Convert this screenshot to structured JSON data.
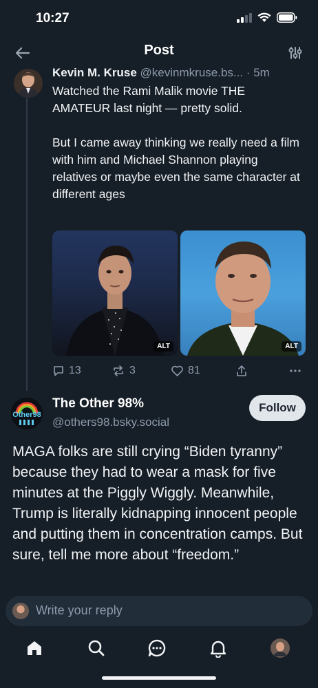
{
  "status": {
    "time": "10:27"
  },
  "header": {
    "title": "Post"
  },
  "parent": {
    "author": "Kevin M. Kruse",
    "handle": "@kevinmkruse.bs...",
    "time": "· 5m",
    "text": "Watched the Rami Malik movie THE AMATEUR last night — pretty solid.\n\nBut I came away thinking we really need a film with him and Michael Shannon playing relatives or maybe even the same character at different ages",
    "images": [
      {
        "alt_label": "ALT"
      },
      {
        "alt_label": "ALT"
      }
    ],
    "stats": {
      "replies": "13",
      "reposts": "3",
      "likes": "81"
    }
  },
  "reply": {
    "author": "The Other 98%",
    "handle": "@others98.bsky.social",
    "follow_label": "Follow",
    "avatar_text": "Other98",
    "text": "MAGA folks are still crying “Biden tyranny” because they had to wear a mask for five minutes at the Piggly Wiggly. Meanwhile, Trump is literally kidnapping innocent people and putting them in concentration camps. But sure, tell me more about “freedom.”"
  },
  "composer": {
    "placeholder": "Write your reply"
  },
  "tabs": [
    "home-icon",
    "search-icon",
    "chat-icon",
    "bell-icon",
    "profile-avatar"
  ]
}
